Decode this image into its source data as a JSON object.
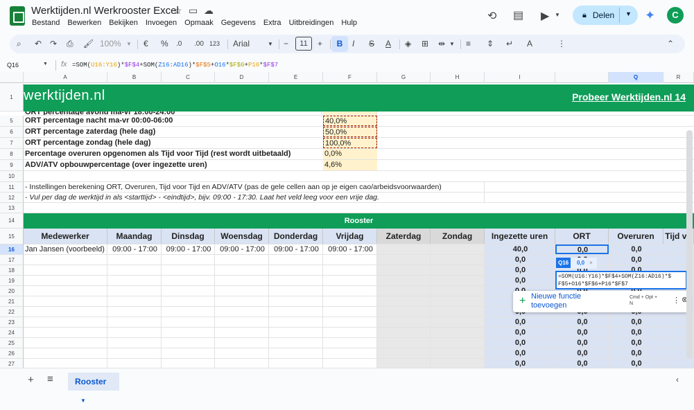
{
  "app": {
    "title": "Werktijden.nl Werkrooster Excel",
    "share_label": "Delen",
    "avatar_letter": "C"
  },
  "menu": [
    "Bestand",
    "Bewerken",
    "Bekijken",
    "Invoegen",
    "Opmaak",
    "Gegevens",
    "Extra",
    "Uitbreidingen",
    "Hulp"
  ],
  "toolbar": {
    "zoom": "100%",
    "currency": "€",
    "percent": "%",
    "dec_minus": ".0",
    "dec_plus": ".00",
    "number_format": "123",
    "font": "Arial",
    "font_size": "11"
  },
  "formula_bar": {
    "cell_ref": "Q16",
    "formula_parts": [
      "=SOM(",
      "U16:Y16",
      ")*",
      "$F$4",
      "+SOM(",
      "Z16:AD16",
      ")*",
      "$F$5",
      "+",
      "O16",
      "*",
      "$F$6",
      "+",
      "P16",
      "*",
      "$F$7"
    ]
  },
  "columns": [
    "A",
    "B",
    "C",
    "D",
    "E",
    "F",
    "G",
    "H",
    "I",
    "",
    "Q",
    "R"
  ],
  "selected_column": "Q",
  "banner": {
    "logo_text": "werktijden.nl",
    "cta": "Probeer Werktijden.nl 14"
  },
  "settings_rows": [
    {
      "row": "5",
      "label": "ORT percentage nacht ma-vr 00:00-06:00",
      "value": "40,0%"
    },
    {
      "row": "6",
      "label": "ORT percentage zaterdag (hele dag)",
      "value": "50,0%"
    },
    {
      "row": "7",
      "label": "ORT percentage zondag (hele dag)",
      "value": "100,0%"
    },
    {
      "row": "8",
      "label": "Percentage overuren opgenomen als Tijd voor Tijd (rest wordt uitbetaald)",
      "value": "0,0%"
    },
    {
      "row": "9",
      "label": "ADV/ATV opbouwpercentage (over ingezette uren)",
      "value": "4,6%"
    }
  ],
  "partial_row_label": "ORT percentage avond ma-vr 18:00-24:00",
  "notes": {
    "row11": "- Instellingen berekening ORT, Overuren, Tijd voor Tijd en ADV/ATV (pas de gele cellen aan op je eigen cao/arbeidsvoorwaarden)",
    "row12": "- Vul per dag de werktijd in als <starttijd> - <eindtijd>, bijv. 09:00 - 17:30. Laat het veld leeg voor een vrije dag."
  },
  "rooster_title": "Rooster",
  "table_headers": [
    "Medewerker",
    "Maandag",
    "Dinsdag",
    "Woensdag",
    "Donderdag",
    "Vrijdag",
    "Zaterdag",
    "Zondag",
    "Ingezette uren",
    "ORT",
    "Overuren",
    "Tijd vo"
  ],
  "first_row": {
    "name": "Jan Jansen (voorbeeld)",
    "times": [
      "09:00 - 17:00",
      "09:00 - 17:00",
      "09:00 - 17:00",
      "09:00 - 17:00",
      "09:00 - 17:00"
    ],
    "ingezet": "40,0",
    "ort": "0,0",
    "overuren": "0,0"
  },
  "zero_value": "0,0",
  "row_numbers": [
    "1",
    "5",
    "6",
    "7",
    "8",
    "9",
    "10",
    "11",
    "12",
    "13",
    "14",
    "15",
    "16",
    "17",
    "18",
    "19",
    "20",
    "21",
    "22",
    "23",
    "24",
    "25",
    "26",
    "27"
  ],
  "popup": {
    "chip_ref": "Q16",
    "chip_val": "0,0",
    "editor_line1": "=SOM(U16:Y16)*$F$4+SOM(Z16:AD16)*$",
    "editor_line2": "F$5+O16*$F$6+P16*$F$7",
    "suggest_label_1": "Nieuwe functie",
    "suggest_label_2": "toevoegen",
    "shortcut": "Cmd + Opt +",
    "shortcut2": "N"
  },
  "sheet_tab": "Rooster"
}
